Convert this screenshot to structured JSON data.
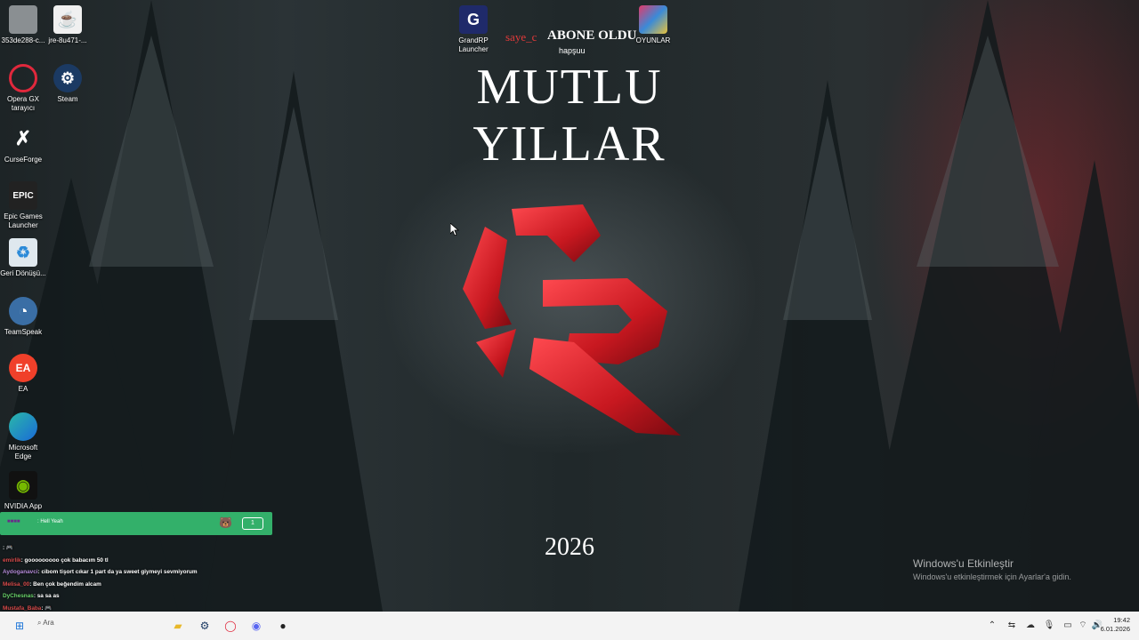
{
  "desktop": {
    "icons": [
      {
        "label": "353de288-c...",
        "icon": "file-icon"
      },
      {
        "label": "jre-8u471-...",
        "icon": "java-icon"
      },
      {
        "label": "Opera GX tarayıcı",
        "icon": "opera-gx-icon"
      },
      {
        "label": "Steam",
        "icon": "steam-icon"
      },
      {
        "label": "CurseForge",
        "icon": "curseforge-icon"
      },
      {
        "label": "Epic Games Launcher",
        "icon": "epic-games-icon"
      },
      {
        "label": "Geri Dönüşü...",
        "icon": "recycle-bin-icon"
      },
      {
        "label": "TeamSpeak",
        "icon": "teamspeak-icon"
      },
      {
        "label": "EA",
        "icon": "ea-icon"
      },
      {
        "label": "Microsoft Edge",
        "icon": "edge-icon"
      },
      {
        "label": "NVIDIA App",
        "icon": "nvidia-icon"
      },
      {
        "label": "GrandRP Launcher",
        "icon": "grandrp-icon"
      },
      {
        "label": "OYUNLAR",
        "icon": "folder-games-icon"
      }
    ]
  },
  "wallpaper": {
    "title": "MUTLU YILLAR",
    "year": "2026"
  },
  "sub_alert": {
    "user": "saye_c",
    "message": "ABONE OLDU",
    "sub": "hapşuu"
  },
  "activation": {
    "heading": "Windows'u Etkinleştir",
    "subtext": "Windows'u etkinleştirmek için Ayarlar'a gidin."
  },
  "chat_overlay": {
    "top_bar_text": ": Hell Yeah",
    "top_bar_count": "1",
    "messages": [
      {
        "user": "",
        "text": ": 🎮"
      },
      {
        "user": "emirlik",
        "text": ": gooooooooo çok babacım 50 tl"
      },
      {
        "user": "Aydoganavci",
        "text": ": cibom tişort cıkar 1 part da ya sweet giymeyi sevmiyorum"
      },
      {
        "user": "Melisa_00",
        "text": ": Ben çok beğendim alcam"
      },
      {
        "user": "DyChesnas",
        "text": ": sa sa as"
      },
      {
        "user": "Mustafa_Baba",
        "text": ": 🎮"
      }
    ]
  },
  "taskbar": {
    "search_placeholder": "Ara",
    "time": "19:42",
    "date": "6.01.2026",
    "pinned": [
      "start-icon",
      "search-icon",
      "file-explorer-icon",
      "steam-icon",
      "opera-gx-icon",
      "discord-icon",
      "obs-icon"
    ],
    "tray": [
      "chevron-up-icon",
      "network-icon",
      "onedrive-icon",
      "microphone-icon",
      "display-icon",
      "wifi-icon",
      "volume-icon"
    ]
  },
  "colors": {
    "accent_red": "#d8202a",
    "chat_bar_green": "#33b06a",
    "taskbar_bg": "#f3f3f3"
  }
}
